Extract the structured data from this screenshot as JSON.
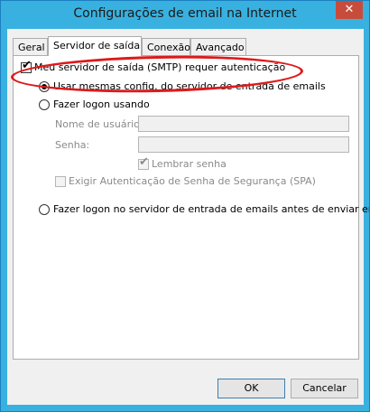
{
  "window": {
    "title": "Configurações de email na Internet",
    "close_glyph": "✕"
  },
  "tabs": [
    {
      "label": "Geral"
    },
    {
      "label": "Servidor de saída"
    },
    {
      "label": "Conexão"
    },
    {
      "label": "Avançado"
    }
  ],
  "outgoing": {
    "requires_auth": {
      "label": "Meu servidor de saída (SMTP) requer autenticação",
      "checked": true
    },
    "use_same": {
      "label": "Usar mesmas config. do servidor de entrada de emails",
      "selected": true
    },
    "logon_using": {
      "label": "Fazer logon usando",
      "selected": false
    },
    "username": {
      "label": "Nome de usuário:",
      "value": ""
    },
    "password": {
      "label": "Senha:",
      "value": ""
    },
    "remember_password": {
      "label": "Lembrar senha",
      "checked": true
    },
    "spa": {
      "label": "Exigir Autenticação de Senha de Segurança (SPA)",
      "checked": false
    },
    "logon_incoming_first": {
      "label": "Fazer logon no servidor de entrada de emails antes de enviar email",
      "selected": false
    }
  },
  "buttons": {
    "ok": "OK",
    "cancel": "Cancelar"
  },
  "colors": {
    "title_bar": "#39b1e0",
    "close_button": "#c74c3c",
    "annotation_ellipse": "#dd1a1a"
  }
}
